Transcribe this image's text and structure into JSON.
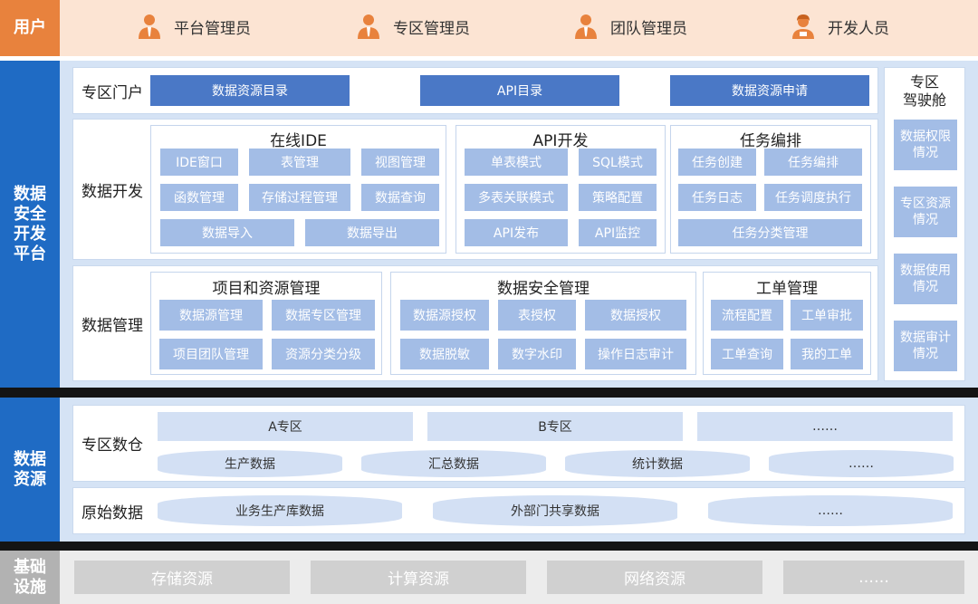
{
  "sides": {
    "user": "用户",
    "platform": "数据\n安全\n开发\n平台",
    "resource": "数据\n资源",
    "infra": "基础\n设施"
  },
  "users": [
    "平台管理员",
    "专区管理员",
    "团队管理员",
    "开发人员"
  ],
  "portal": {
    "label": "专区门户",
    "buttons": [
      "数据资源目录",
      "API目录",
      "数据资源申请"
    ]
  },
  "dev": {
    "label": "数据开发",
    "ide": {
      "title": "在线IDE",
      "items": [
        "IDE窗口",
        "表管理",
        "视图管理",
        "函数管理",
        "存储过程管理",
        "数据查询",
        "数据导入",
        "数据导出"
      ]
    },
    "api": {
      "title": "API开发",
      "items": [
        "单表模式",
        "SQL模式",
        "多表关联模式",
        "策略配置",
        "API发布",
        "API监控"
      ]
    },
    "task": {
      "title": "任务编排",
      "items": [
        "任务创建",
        "任务编排",
        "任务日志",
        "任务调度执行",
        "任务分类管理"
      ]
    }
  },
  "mgmt": {
    "label": "数据管理",
    "proj": {
      "title": "项目和资源管理",
      "items": [
        "数据源管理",
        "数据专区管理",
        "项目团队管理",
        "资源分类分级"
      ]
    },
    "sec": {
      "title": "数据安全管理",
      "items": [
        "数据源授权",
        "表授权",
        "数据授权",
        "数据脱敏",
        "数字水印",
        "操作日志审计"
      ]
    },
    "order": {
      "title": "工单管理",
      "items": [
        "流程配置",
        "工单审批",
        "工单查询",
        "我的工单"
      ]
    }
  },
  "cockpit": {
    "title": "专区\n驾驶舱",
    "items": [
      "数据权限\n情况",
      "专区资源\n情况",
      "数据使用\n情况",
      "数据审计\n情况"
    ]
  },
  "warehouse": {
    "label": "专区数仓",
    "zones": [
      "A专区",
      "B专区",
      "……"
    ],
    "data": [
      "生产数据",
      "汇总数据",
      "统计数据",
      "……"
    ]
  },
  "raw": {
    "label": "原始数据",
    "items": [
      "业务生产库数据",
      "外部门共享数据",
      "……"
    ]
  },
  "infra": {
    "items": [
      "存储资源",
      "计算资源",
      "网络资源",
      "……"
    ]
  },
  "colors": {
    "orange": "#e8823d",
    "blue": "#1f6bc4",
    "dark_button": "#4a78c6",
    "light_button": "#a3bde6",
    "gray": "#b2b2b2"
  }
}
